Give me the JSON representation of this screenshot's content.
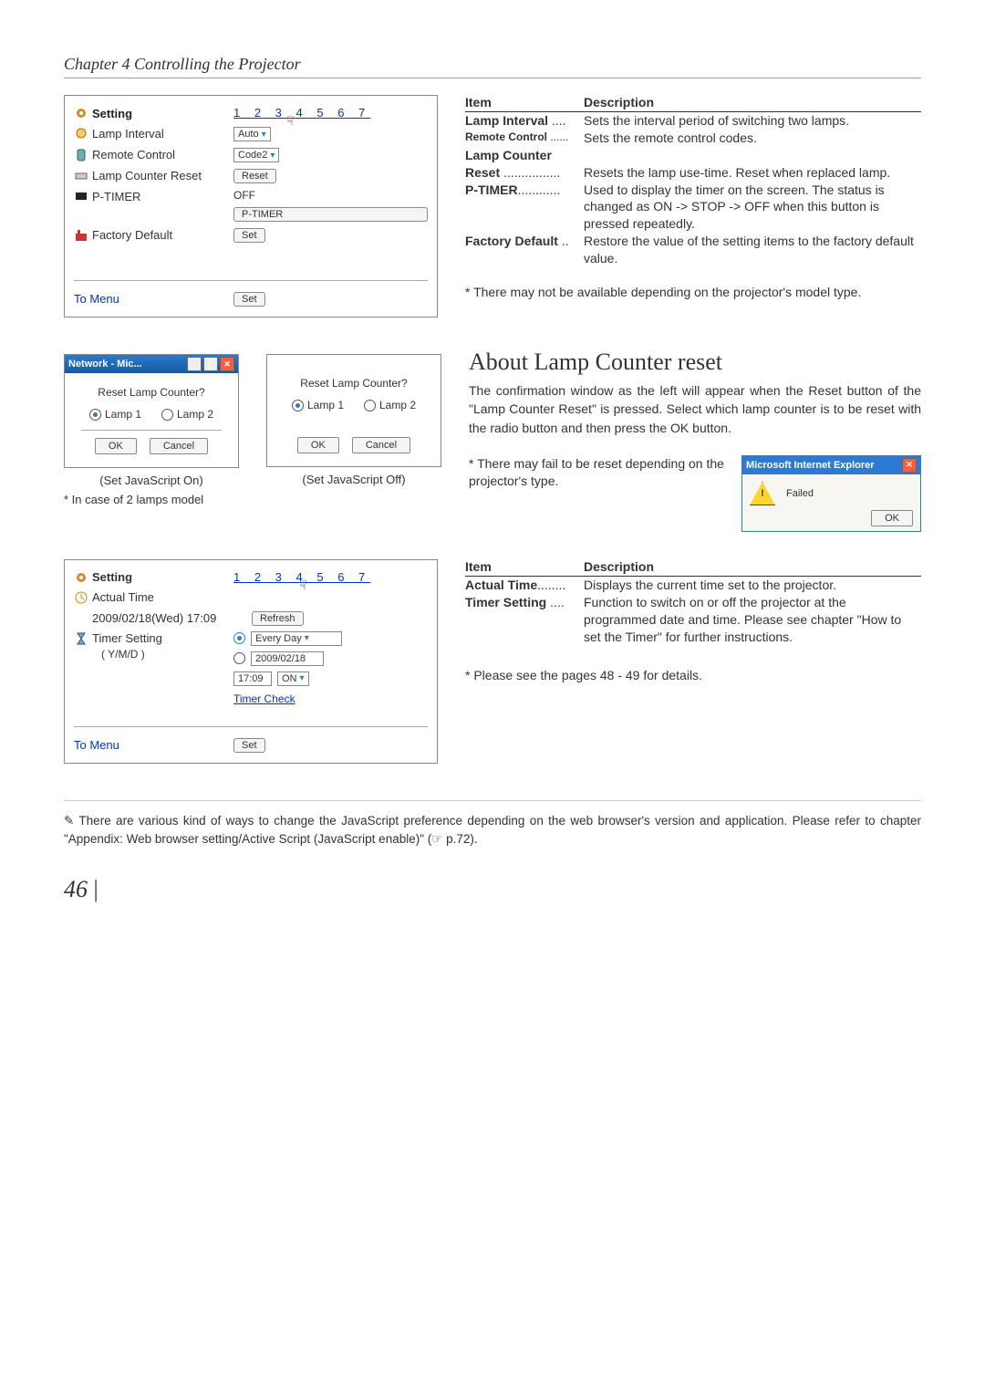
{
  "chapter_title": "Chapter 4 Controlling the Projector",
  "panel1": {
    "heading": "Setting",
    "pages": "1 2 3 4 5 6 7",
    "rows": {
      "lamp_interval": {
        "label": "Lamp Interval",
        "control": "Auto"
      },
      "remote_control": {
        "label": "Remote Control",
        "control": "Code2"
      },
      "lamp_counter_reset": {
        "label": "Lamp Counter Reset",
        "control": "Reset"
      },
      "p_timer": {
        "label": "P-TIMER",
        "status": "OFF",
        "button": "P-TIMER"
      },
      "factory_default": {
        "label": "Factory Default",
        "control": "Set"
      }
    },
    "to_menu": "To Menu",
    "set": "Set"
  },
  "table1_header": {
    "item": "Item",
    "desc": "Description"
  },
  "table1": {
    "lamp_interval": {
      "item": "Lamp Interval",
      "dots": " ....",
      "desc": "Sets the interval period of switching two lamps."
    },
    "remote_control": {
      "item": "Remote Control",
      "dots": " ......",
      "desc": "Sets the remote control codes."
    },
    "lamp_counter": {
      "item": "Lamp Counter"
    },
    "reset": {
      "item": " Reset",
      "dots": " ................",
      "desc": "Resets the lamp use-time. Reset when replaced lamp."
    },
    "p_timer": {
      "item": "P-TIMER",
      "dots": "............",
      "desc": "Used to display the timer on the screen. The status is changed as ON -> STOP -> OFF when this button is pressed repeatedly."
    },
    "factory_default": {
      "item": "Factory Default",
      "dots": " ..",
      "desc": "Restore the value of the setting items to the factory default value."
    }
  },
  "note1": "* There may not be available depending on the projector's model type.",
  "section_heading": "About Lamp Counter reset",
  "section_body": "The confirmation window as the left will appear when the Reset button of the \"Lamp Counter Reset\" is pressed. Select which lamp counter is to be reset with the radio button and then press the OK button.",
  "dialog1": {
    "title": "Network - Mic...",
    "question": "Reset Lamp Counter?",
    "lamp1": "Lamp 1",
    "lamp2": "Lamp 2",
    "ok": "OK",
    "cancel": "Cancel",
    "caption_on": "(Set JavaScript On)",
    "caption_off": "(Set JavaScript Off)",
    "caption_note": "* In case of 2 lamps model"
  },
  "note2": "* There may fail to be reset depending on the projector's type.",
  "ie_dialog": {
    "title": "Microsoft Internet Explorer",
    "msg": "Failed",
    "ok": "OK"
  },
  "panel2": {
    "heading": "Setting",
    "pages": "1 2 3 4 5 6 7",
    "actual_time": {
      "label": "Actual Time",
      "datetime": "2009/02/18(Wed) 17:09",
      "refresh": "Refresh"
    },
    "timer_setting": {
      "label": "Timer Setting",
      "sub": "( Y/M/D )",
      "mode": "Every Day",
      "date": "2009/02/18",
      "time": "17:09",
      "onoff": "ON",
      "check": "Timer Check"
    },
    "to_menu": "To Menu",
    "set": "Set"
  },
  "table2_header": {
    "item": "Item",
    "desc": "Description"
  },
  "table2": {
    "actual_time": {
      "item": "Actual Time",
      "dots": "........",
      "desc": "Displays the current time set to the projector."
    },
    "timer_setting": {
      "item": "Timer Setting",
      "dots": " ....",
      "desc": "Function to switch on or off the projector at the programmed date and time. Please see chapter \"How to set the Timer\" for further instructions."
    }
  },
  "note3": "* Please see the pages 48 - 49 for details.",
  "footnote": "✎ There are various kind of ways to change the JavaScript preference depending on the web browser's version and application. Please refer to chapter \"Appendix: Web browser setting/Active Script (JavaScript enable)\" (☞ p.72).",
  "page_number": "46"
}
